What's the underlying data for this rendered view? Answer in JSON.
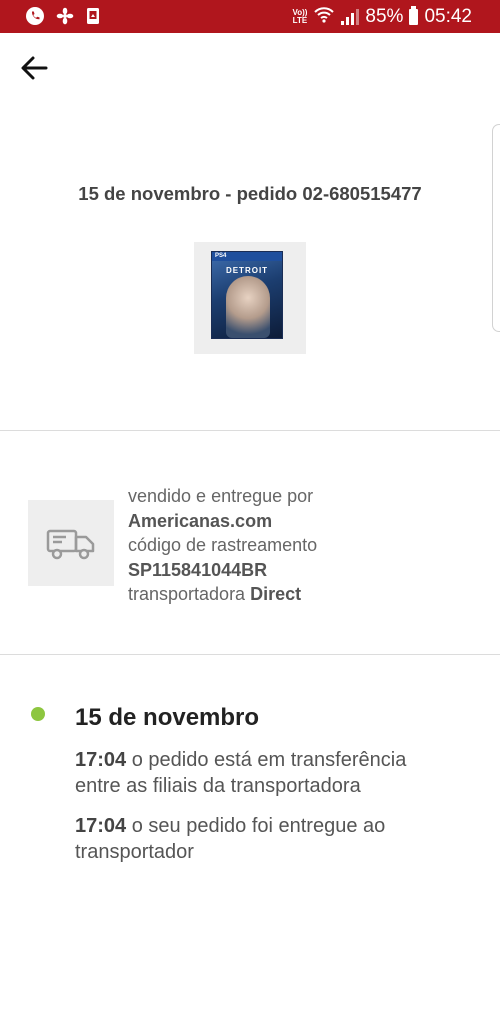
{
  "status_bar": {
    "volte_top": "Vo))",
    "volte_bottom": "LTE",
    "battery": "85%",
    "time": "05:42",
    "icons": [
      "phone-icon",
      "fan-icon",
      "card-icon",
      "wifi-icon",
      "signal-icon",
      "battery-icon"
    ]
  },
  "order": {
    "header": "15 de novembro - pedido 02-680515477",
    "product": {
      "platform": "PS4",
      "title": "DETROIT"
    }
  },
  "seller": {
    "icon": "truck-icon",
    "sold_by_label": "vendido e entregue por",
    "sold_by_name": "Americanas.com",
    "tracking_label": "código de rastreamento",
    "tracking_code": "SP115841044BR",
    "carrier_label": "transportadora",
    "carrier_name": "Direct"
  },
  "timeline": {
    "date": "15 de novembro",
    "dot_color": "#8dc63f",
    "events": [
      {
        "time": "17:04",
        "text": "o pedido está em transferência entre as filiais da transportadora"
      },
      {
        "time": "17:04",
        "text": "o seu pedido foi entregue ao transportador"
      }
    ]
  },
  "colors": {
    "status_bar": "#b0161d",
    "accent_dot": "#8dc63f"
  }
}
